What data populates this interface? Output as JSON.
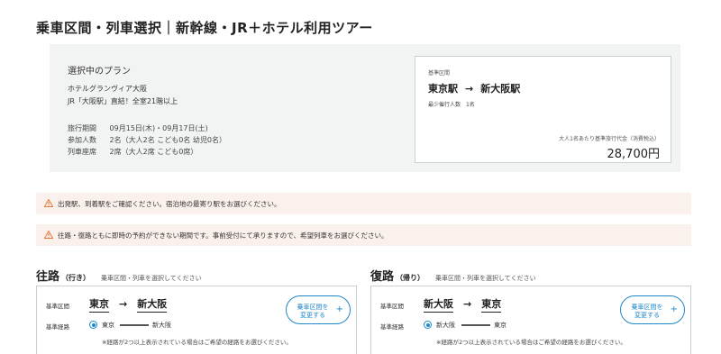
{
  "page": {
    "title": "乗車区間・列車選択｜新幹線・JR＋ホテル利用ツアー"
  },
  "plan": {
    "heading": "選択中のプラン",
    "hotel_name": "ホテルグランヴィア大阪",
    "hotel_note": "JR「大阪駅」直結！全室21階以上",
    "rows": [
      {
        "label": "旅行期間",
        "value": "09月15日(木)・09月17日(土)"
      },
      {
        "label": "参加人数",
        "value": "2名（大人2名 こども0名 幼児0名）"
      },
      {
        "label": "列車座席",
        "value": "2席（大人2席 こども0席）"
      }
    ]
  },
  "summary": {
    "caption": "基準区間",
    "from": "東京駅",
    "arrow": "→",
    "to": "新大阪駅",
    "min_label": "最少催行人数",
    "min_value": "1名",
    "price_label": "大人1名あたり基準旅行代金（消費税込）",
    "price": "28,700円"
  },
  "notices": [
    "出発駅、到着駅をご確認ください。宿泊地の最寄り駅をお選びください。",
    "往路・復路ともに即時の予約ができない期間です。事前受付にて承りますので、希望列車をお選びください。"
  ],
  "outbound": {
    "title": "往路",
    "sub": "（行き）",
    "hint": "乗車区間・列車を選択してください",
    "section_label": "基準区間",
    "from": "東京",
    "arrow": "→",
    "to": "新大阪",
    "route_label": "基準経路",
    "route_from": "東京",
    "route_to": "新大阪",
    "note": "※経路が2つ以上表示されている場合はご希望の経路をお選びください。",
    "button_line1": "乗車区間を",
    "button_line2": "変更する",
    "button_plus": "+"
  },
  "return": {
    "title": "復路",
    "sub": "（帰り）",
    "hint": "乗車区間・列車を選択してください",
    "section_label": "基準区間",
    "from": "新大阪",
    "arrow": "→",
    "to": "東京",
    "route_label": "基準経路",
    "route_from": "新大阪",
    "route_to": "東京",
    "note": "※経路が2つ以上表示されている場合はご希望の経路をお選びください。",
    "button_line1": "乗車区間を",
    "button_line2": "変更する",
    "button_plus": "+"
  },
  "icons": {
    "notice": "warning-icon",
    "radio": "radio-selected-icon"
  },
  "colors": {
    "accent": "#1e88c8",
    "notice_bg": "#fbf1ec",
    "warning": "#e07b39",
    "panel_bg": "#f2f4f3"
  }
}
